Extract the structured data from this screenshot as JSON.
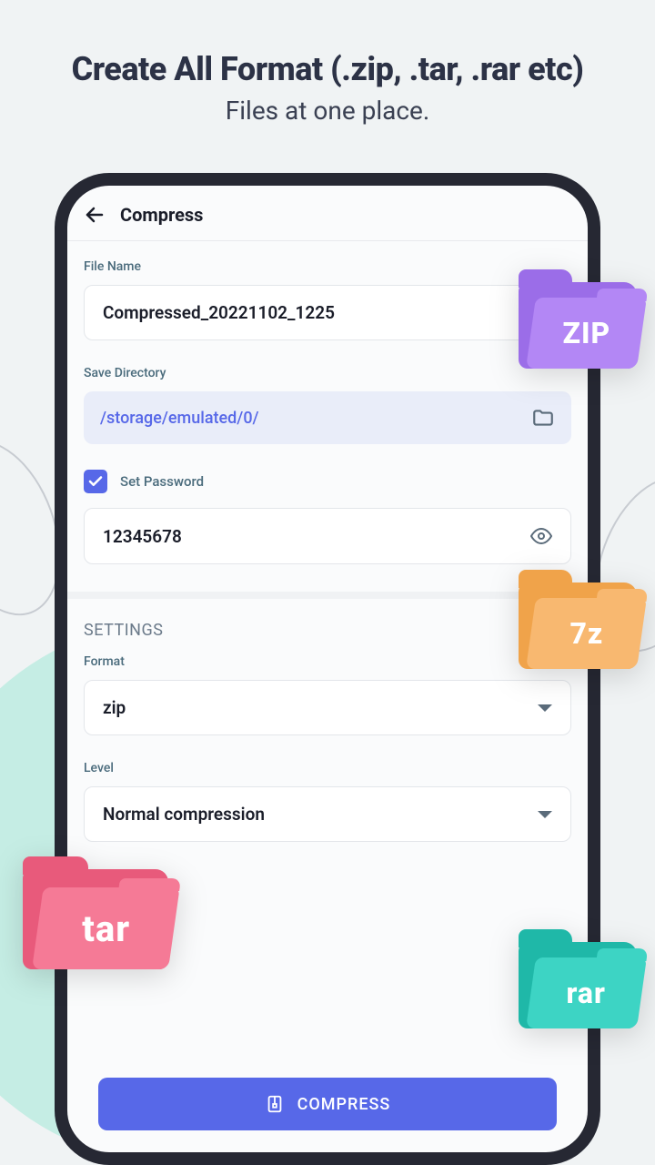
{
  "headline": {
    "title": "Create All Format (.zip, .tar, .rar etc)",
    "subtitle": "Files at one place."
  },
  "app": {
    "title": "Compress"
  },
  "form": {
    "file_name_label": "File Name",
    "file_name_value": "Compressed_20221102_1225",
    "save_dir_label": "Save Directory",
    "save_dir_value": "/storage/emulated/0/",
    "set_password_label": "Set Password",
    "set_password_checked": true,
    "password_value": "12345678"
  },
  "settings": {
    "section_title": "SETTINGS",
    "format_label": "Format",
    "format_value": "zip",
    "level_label": "Level",
    "level_value": "Normal compression"
  },
  "action": {
    "compress_label": "COMPRESS"
  },
  "folders": {
    "zip": "ZIP",
    "sevenz": "7z",
    "tar": "tar",
    "rar": "rar"
  },
  "colors": {
    "zip_back": "#9b6de8",
    "zip_front": "#b387f5",
    "sevenz_back": "#f0a34a",
    "sevenz_front": "#f8b870",
    "tar_back": "#e85a7b",
    "tar_front": "#f57a96",
    "rar_back": "#1fb8a8",
    "rar_front": "#3dd4c4"
  }
}
